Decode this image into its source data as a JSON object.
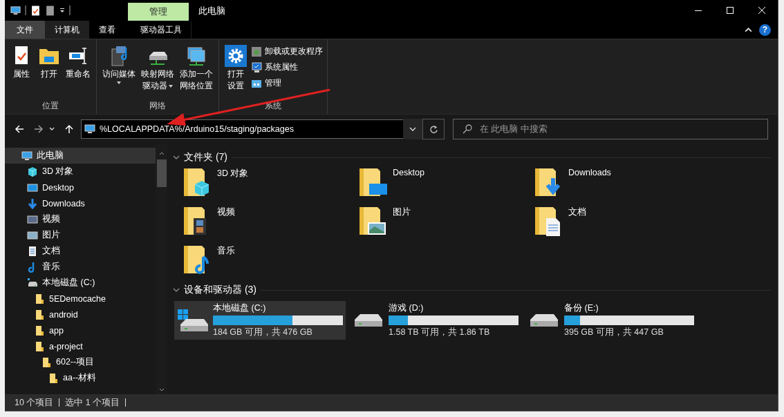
{
  "window": {
    "title": "此电脑",
    "context_tab": "管理"
  },
  "help": {
    "label": "?"
  },
  "tabs": [
    {
      "label": "文件",
      "kind": "file",
      "selected": false
    },
    {
      "label": "计算机",
      "kind": "normal",
      "selected": true
    },
    {
      "label": "查看",
      "kind": "normal",
      "selected": false
    },
    {
      "label": "驱动器工具",
      "kind": "context",
      "selected": false
    }
  ],
  "ribbon": {
    "groups": [
      {
        "label": "位置",
        "buttons": [
          {
            "lines": [
              "属性"
            ],
            "kind": "properties",
            "dropdown": false
          },
          {
            "lines": [
              "打开"
            ],
            "kind": "open",
            "dropdown": false
          },
          {
            "lines": [
              "重命名"
            ],
            "kind": "rename",
            "dropdown": false
          }
        ]
      },
      {
        "label": "网络",
        "buttons": [
          {
            "lines": [
              "访问媒体"
            ],
            "kind": "media",
            "dropdown": true
          },
          {
            "lines": [
              "映射网络",
              "驱动器"
            ],
            "kind": "mapping",
            "dropdown": true
          },
          {
            "lines": [
              "添加一个",
              "网络位置"
            ],
            "kind": "location",
            "dropdown": false
          }
        ]
      },
      {
        "label": "系统",
        "buttons": [
          {
            "lines": [
              "打开",
              "设置"
            ],
            "kind": "settings",
            "dropdown": false
          }
        ],
        "small": [
          {
            "label": "卸载或更改程序",
            "kind": "uninstall"
          },
          {
            "label": "系统属性",
            "kind": "sysprops"
          },
          {
            "label": "管理",
            "kind": "manage"
          }
        ]
      }
    ]
  },
  "address": {
    "value": "%LOCALAPPDATA%/Arduino15/staging/packages"
  },
  "search": {
    "placeholder": "在 此电脑 中搜索"
  },
  "sidebar": {
    "items": [
      {
        "label": "此电脑",
        "kind": "pc",
        "selected": true,
        "children": [
          {
            "label": "3D 对象",
            "kind": "objects",
            "selected": false
          },
          {
            "label": "Desktop",
            "kind": "desktop",
            "selected": false
          },
          {
            "label": "Downloads",
            "kind": "downloads",
            "selected": false
          },
          {
            "label": "视频",
            "kind": "video",
            "selected": false
          },
          {
            "label": "图片",
            "kind": "pictures",
            "selected": false
          },
          {
            "label": "文档",
            "kind": "documents",
            "selected": false
          },
          {
            "label": "音乐",
            "kind": "music",
            "selected": false
          },
          {
            "label": "本地磁盘 (C:)",
            "kind": "drive",
            "selected": false,
            "children": [
              {
                "label": "5EDemocache",
                "kind": "folder",
                "selected": false
              },
              {
                "label": "android",
                "kind": "folder",
                "selected": false
              },
              {
                "label": "app",
                "kind": "folder",
                "selected": false
              },
              {
                "label": "a-project",
                "kind": "folder",
                "selected": false,
                "children": [
                  {
                    "label": "602--项目",
                    "kind": "folder",
                    "selected": false,
                    "children": [
                      {
                        "label": "aa--材料",
                        "kind": "folder",
                        "selected": false
                      }
                    ]
                  }
                ]
              }
            ]
          }
        ]
      }
    ]
  },
  "folders": {
    "title": "文件夹 (7)",
    "items": [
      {
        "name": "3D 对象",
        "kind": "objects"
      },
      {
        "name": "Desktop",
        "kind": "desktop"
      },
      {
        "name": "Downloads",
        "kind": "downloads"
      },
      {
        "name": "视频",
        "kind": "video"
      },
      {
        "name": "图片",
        "kind": "pictures"
      },
      {
        "name": "文档",
        "kind": "documents"
      },
      {
        "name": "音乐",
        "kind": "music"
      }
    ]
  },
  "drives": {
    "title": "设备和驱动器 (3)",
    "items": [
      {
        "name": "本地磁盘 (C:)",
        "kind": "system",
        "selected": true,
        "level": 0.61,
        "reading": "184 GB 可用，共 476 GB"
      },
      {
        "name": "游戏 (D:)",
        "kind": "disk",
        "selected": false,
        "level": 0.15,
        "reading": "1.58 TB 可用，共 1.86 TB"
      },
      {
        "name": "备份 (E:)",
        "kind": "disk",
        "selected": false,
        "level": 0.12,
        "reading": "395 GB 可用，共 447 GB"
      }
    ]
  },
  "status_bar": {
    "items": [
      "10 个项目",
      "选中 1 个项目"
    ]
  }
}
